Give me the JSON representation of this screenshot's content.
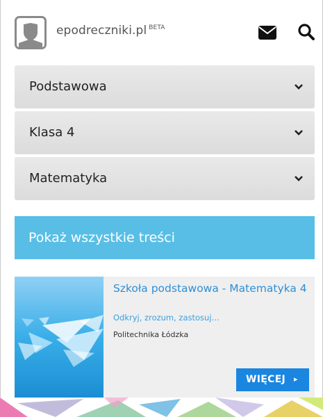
{
  "header": {
    "brand_name": "epodreczniki.pl",
    "beta_badge": "BETA",
    "icons": {
      "logo": "book-shield-logo",
      "mail": "envelope-icon",
      "search": "magnifier-icon"
    }
  },
  "filters": [
    {
      "label": "Podstawowa"
    },
    {
      "label": "Klasa 4"
    },
    {
      "label": "Matematyka"
    }
  ],
  "show_all_label": "Pokaż wszystkie treści",
  "card": {
    "title": "Szkoła podstawowa - Matematyka 4",
    "subtitle": "Odkryj, zrozum, zastosuj...",
    "publisher": "Politechnika Łódzka",
    "more_label": "WIĘCEJ",
    "more_arrow": "▸"
  },
  "colors": {
    "accent_blue": "#59bee6",
    "button_blue": "#1a86e0",
    "title_blue": "#2d8fd6",
    "dropdown_gray": "#e2e2e2"
  }
}
